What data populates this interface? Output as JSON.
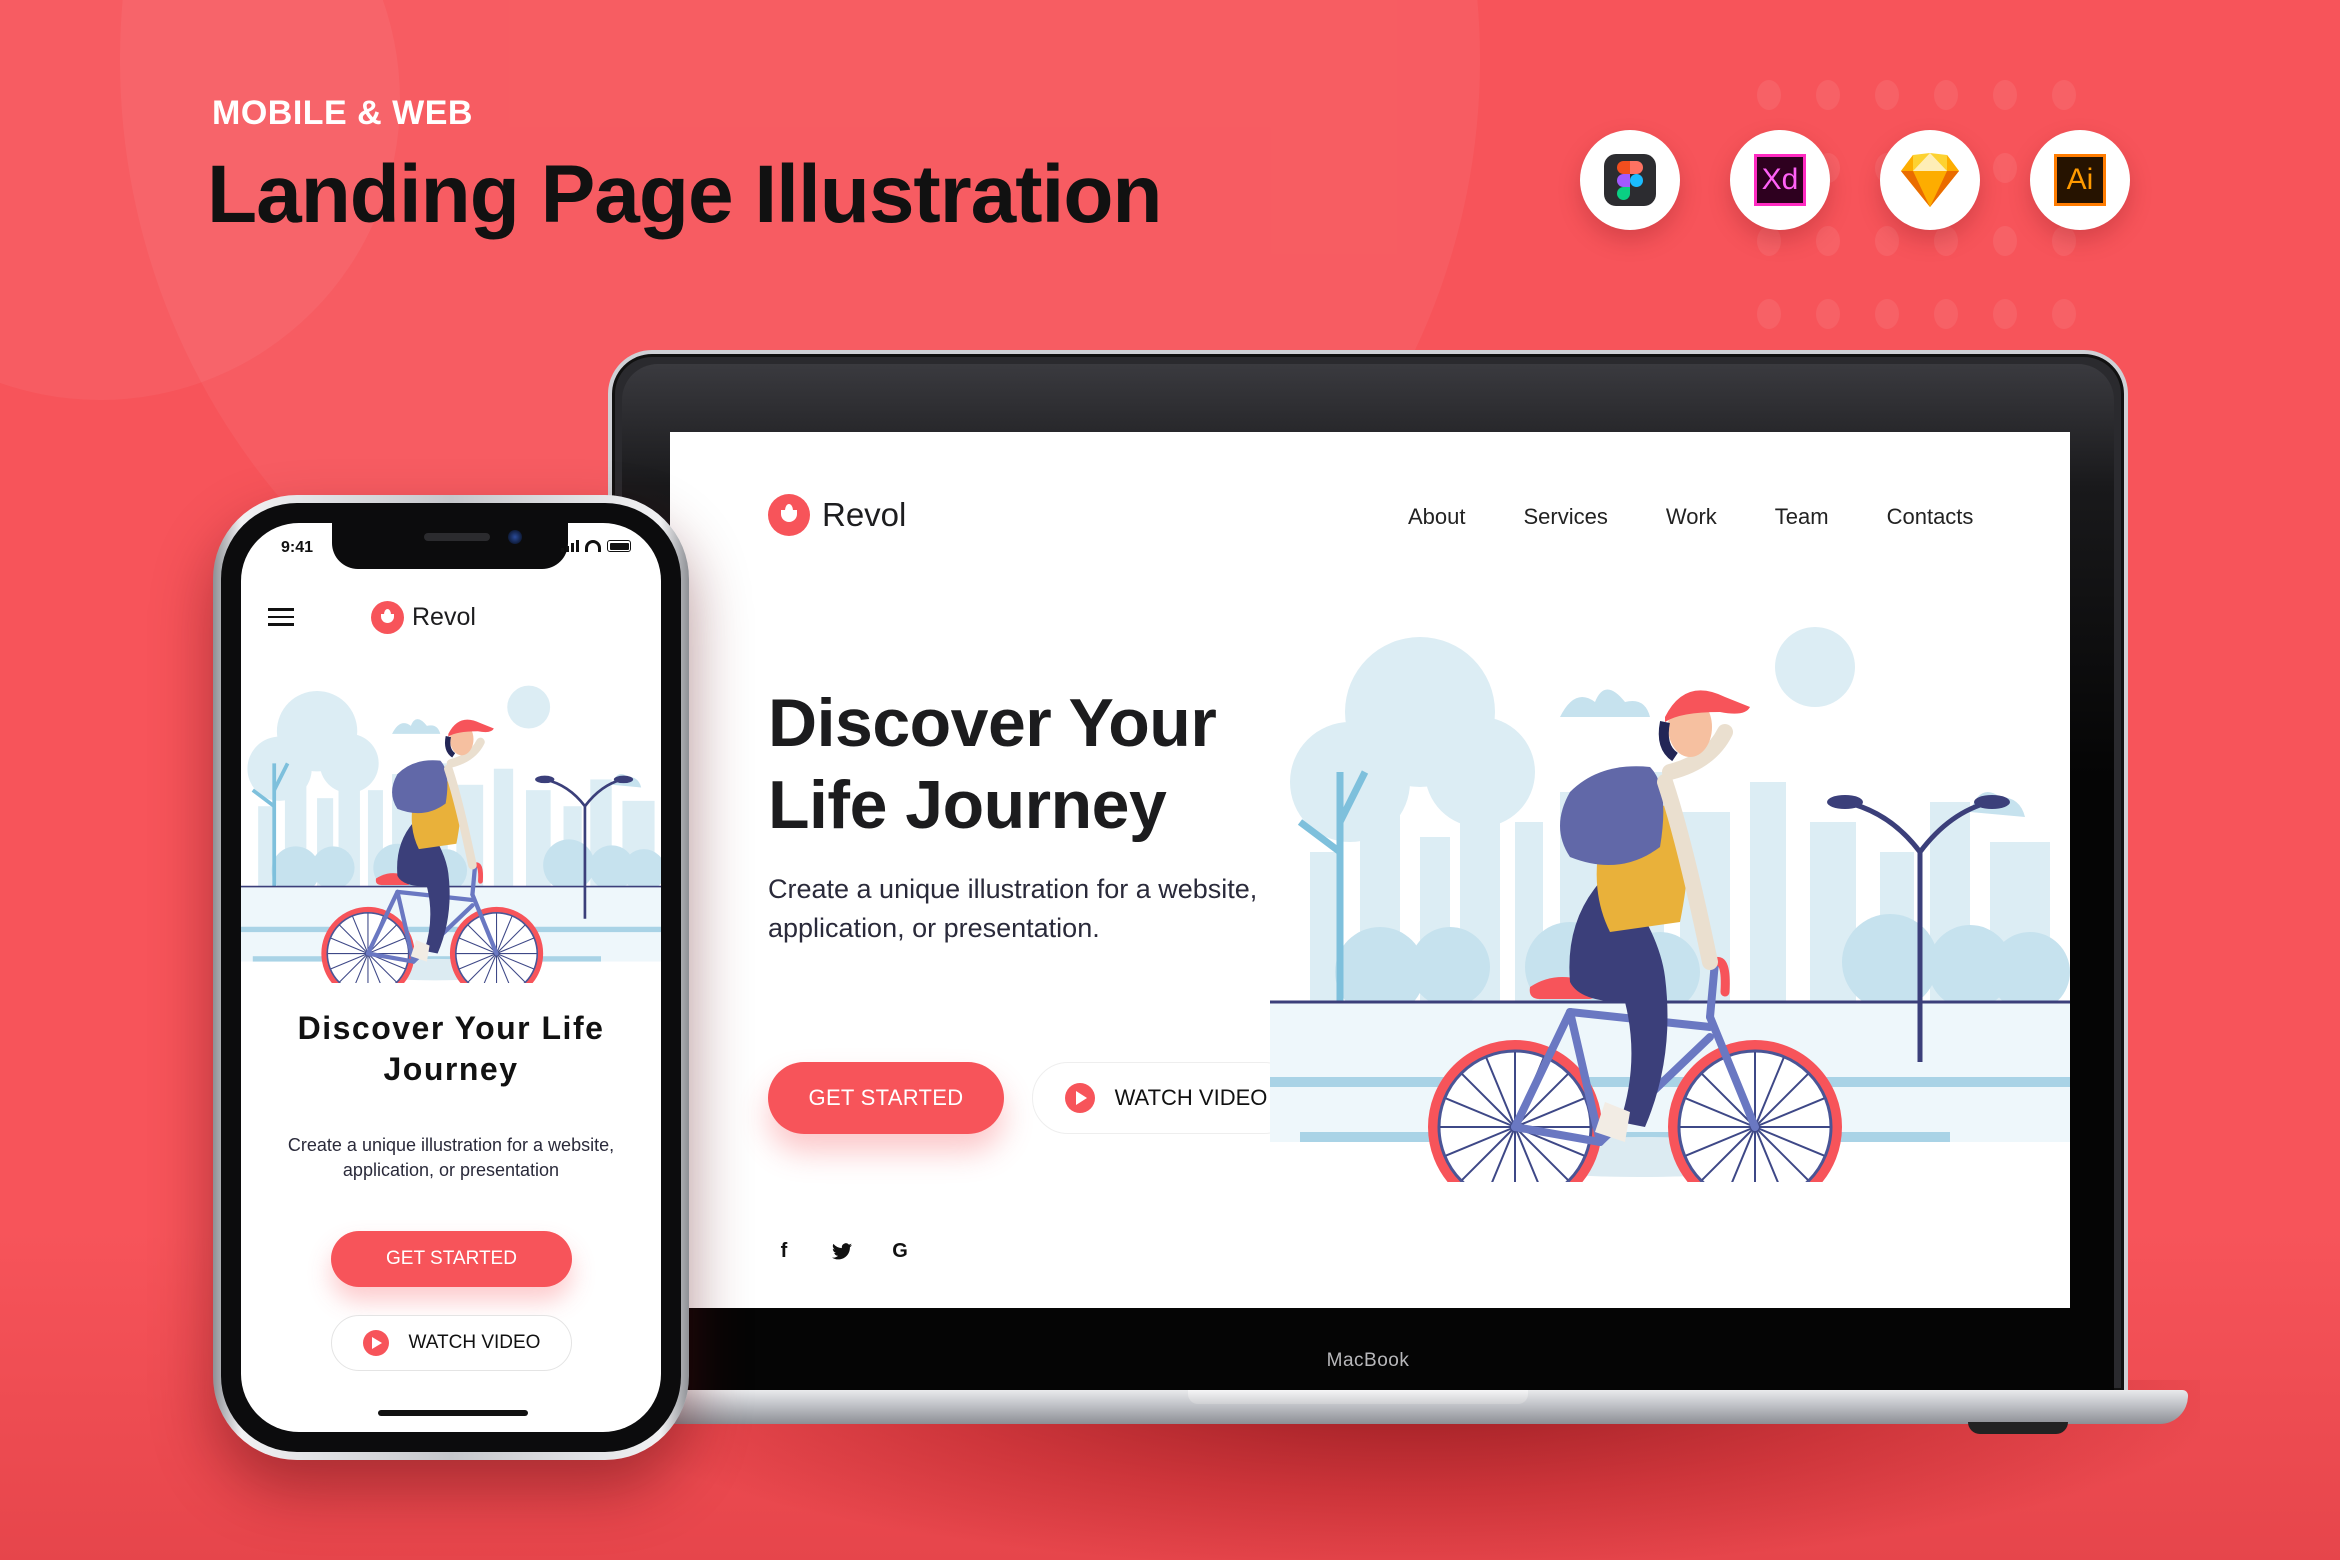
{
  "header": {
    "eyebrow": "MOBILE & WEB",
    "title": "Landing Page Illustration"
  },
  "tools": [
    {
      "name": "Figma",
      "icon": "figma-icon"
    },
    {
      "name": "Adobe XD",
      "icon": "xd-icon",
      "glyph": "Xd"
    },
    {
      "name": "Sketch",
      "icon": "sketch-icon"
    },
    {
      "name": "Adobe Illustrator",
      "icon": "illustrator-icon",
      "glyph": "Ai"
    }
  ],
  "colors": {
    "accent": "#f7545a",
    "background": "#f7545a",
    "text_dark": "#1c1c1e",
    "illustration_sky": "#cfe6f0",
    "illustration_navy": "#3b3f7a",
    "illustration_yellow": "#e9b13a"
  },
  "desktop": {
    "device_label": "MacBook",
    "brand": "Revol",
    "nav": [
      "About",
      "Services",
      "Work",
      "Team",
      "Contacts"
    ],
    "hero_title_line1": "Discover Your",
    "hero_title_line2": "Life Journey",
    "hero_subtitle_line1": "Create a unique illustration for a website,",
    "hero_subtitle_line2": "application, or presentation.",
    "cta_primary": "GET STARTED",
    "cta_secondary": "WATCH VIDEO",
    "socials": [
      {
        "name": "facebook",
        "glyph": "f"
      },
      {
        "name": "twitter",
        "glyph": "🐦"
      },
      {
        "name": "google",
        "glyph": "G"
      }
    ]
  },
  "mobile": {
    "status_time": "9:41",
    "brand": "Revol",
    "hero_title_line1": "Discover Your Life",
    "hero_title_line2": "Journey",
    "hero_subtitle_line1": "Create a unique illustration for a website,",
    "hero_subtitle_line2": "application, or presentation",
    "cta_primary": "GET STARTED",
    "cta_secondary": "WATCH VIDEO"
  }
}
